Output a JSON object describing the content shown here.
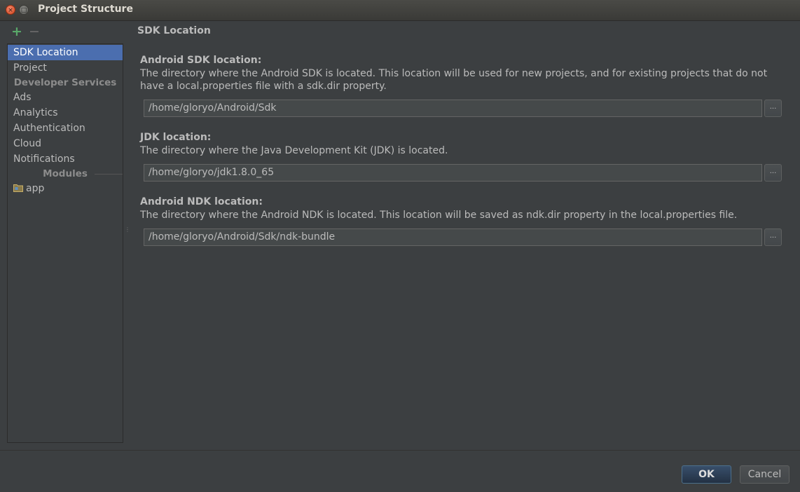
{
  "window": {
    "title": "Project Structure",
    "close_glyph": "×",
    "max_glyph": "□"
  },
  "toolbar": {
    "add_glyph": "+",
    "remove_glyph": "−"
  },
  "sidebar": {
    "items": [
      {
        "label": "SDK Location",
        "selected": true
      },
      {
        "label": "Project"
      }
    ],
    "developer_services_header": "Developer Services",
    "developer_services": [
      {
        "label": "Ads"
      },
      {
        "label": "Analytics"
      },
      {
        "label": "Authentication"
      },
      {
        "label": "Cloud"
      },
      {
        "label": "Notifications"
      }
    ],
    "modules_header": "Modules",
    "modules": [
      {
        "label": "app",
        "icon": "module-folder-icon"
      }
    ]
  },
  "content": {
    "title": "SDK Location",
    "sections": [
      {
        "label": "Android SDK location:",
        "description": "The directory where the Android SDK is located. This location will be used for new projects, and for existing projects that do not have a local.properties file with a sdk.dir property.",
        "path": "/home/gloryo/Android/Sdk",
        "browse_label": "..."
      },
      {
        "label": "JDK location:",
        "description": "The directory where the Java Development Kit (JDK) is located.",
        "path": "/home/gloryo/jdk1.8.0_65",
        "browse_label": "..."
      },
      {
        "label": "Android NDK location:",
        "description": "The directory where the Android NDK is located. This location will be saved as ndk.dir property in the local.properties file.",
        "path": "/home/gloryo/Android/Sdk/ndk-bundle",
        "browse_label": "..."
      }
    ]
  },
  "buttons": {
    "ok": "OK",
    "cancel": "Cancel"
  },
  "colors": {
    "background": "#3c3f41",
    "selection": "#4b6eaf",
    "add_icon": "#59a869",
    "default_button": "#2e4057"
  }
}
